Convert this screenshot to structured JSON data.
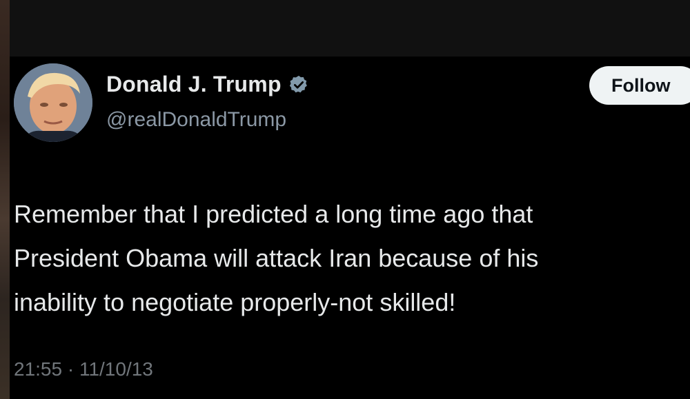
{
  "tweet": {
    "author": {
      "display_name": "Donald J. Trump",
      "handle": "@realDonaldTrump",
      "verified": true,
      "verified_icon": "verified-badge-icon",
      "avatar": "profile-avatar"
    },
    "follow_label": "Follow",
    "text": "Remember that I predicted a long time ago that\nPresident Obama will attack Iran because of his\ninability to negotiate properly-not skilled!",
    "timestamp": "21:55 · 11/10/13"
  },
  "colors": {
    "background": "#000000",
    "text_primary": "#e7e9ea",
    "text_secondary": "#8b98a5",
    "verified_badge": "#829aab",
    "follow_button_bg": "#eff3f4"
  }
}
